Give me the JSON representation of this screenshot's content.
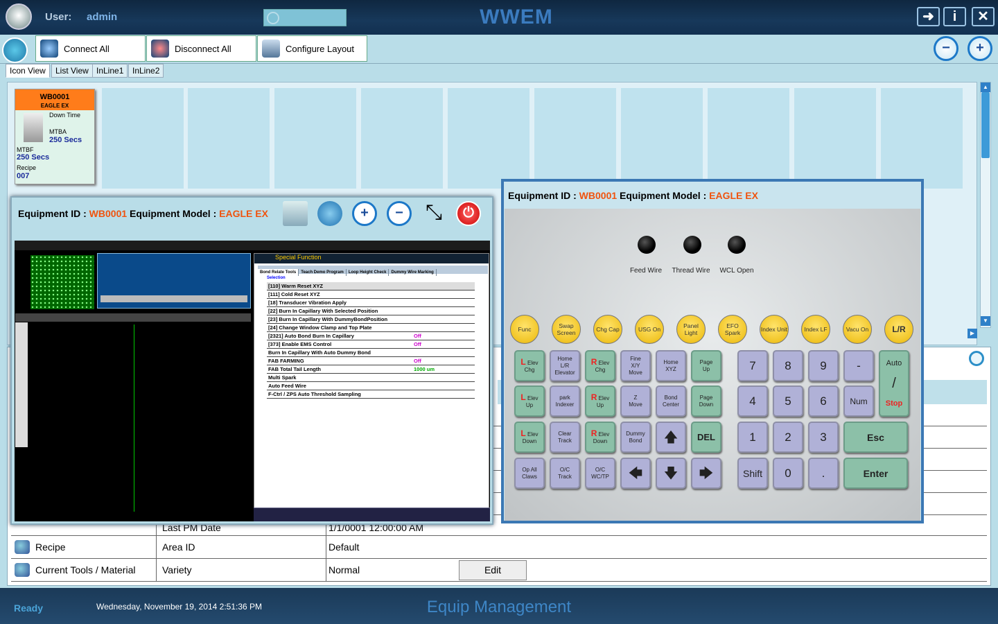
{
  "header": {
    "user_label": "User:",
    "user_name": "admin",
    "app_title": "WWEM"
  },
  "toolbar": {
    "connect_all": "Connect All",
    "disconnect_all": "Disconnect All",
    "configure_layout": "Configure Layout"
  },
  "tabs": [
    "Icon View",
    "List View",
    "InLine1",
    "InLine2"
  ],
  "tile": {
    "id": "WB0001",
    "model": "EAGLE EX",
    "down_time_label": "Down Time",
    "mtba_label": "MTBA",
    "mtba_value": "250 Secs",
    "mtbf_label": "MTBF",
    "mtbf_value": "250 Secs",
    "recipe_label": "Recipe",
    "recipe_value": "007"
  },
  "left_dialog": {
    "eq_id_label": "Equipment ID :",
    "eq_id": "WB0001",
    "eq_model_label": "Equipment Model :",
    "eq_model": "EAGLE EX"
  },
  "right_dialog": {
    "eq_id_label": "Equipment ID :",
    "eq_id": "WB0001",
    "eq_model_label": "Equipment Model :",
    "eq_model": "EAGLE EX"
  },
  "machine_screen": {
    "title": "Special Function",
    "tabs": [
      "Bond Relate Tools",
      "Teach Demo Program",
      "Loop Height Check",
      "Dummy Wire Marking"
    ],
    "selection_label": "Selection",
    "items": [
      {
        "label": "[110] Warm Reset XYZ",
        "status": ""
      },
      {
        "label": "[111] Cold Reset XYZ",
        "status": ""
      },
      {
        "label": "[18] Transducer Vibration Apply",
        "status": ""
      },
      {
        "label": "[22] Burn In Capillary With Selected Position",
        "status": ""
      },
      {
        "label": "[23] Burn In Capillary With DummyBondPosition",
        "status": ""
      },
      {
        "label": "[24] Change Window Clamp and Top Plate",
        "status": ""
      },
      {
        "label": "[2321] Auto Bond Burn In Capillary",
        "status": "Off"
      },
      {
        "label": "[373] Enable EMS Control",
        "status": "Off"
      },
      {
        "label": "Burn In Capillary With Auto Dummy Bond",
        "status": ""
      },
      {
        "label": "FAB FARMING",
        "status": "Off"
      },
      {
        "label": "FAB Total Tail Length",
        "status": "1000  um"
      },
      {
        "label": "Multi Spark",
        "status": ""
      },
      {
        "label": "Auto Feed Wire",
        "status": ""
      },
      {
        "label": "F-Ctrl / ZPS Auto Threshold Sampling",
        "status": ""
      }
    ]
  },
  "keypad": {
    "leds": [
      "Feed Wire",
      "Thread Wire",
      "WCL Open"
    ],
    "yellow_keys": [
      "Func",
      "Swap Screen",
      "Chg Cap",
      "USG On",
      "Panel Light",
      "EFO Spark",
      "Index Unit",
      "Index LF",
      "Vacu On",
      "L/R"
    ],
    "num_keys": [
      "7",
      "8",
      "9",
      "-",
      "4",
      "5",
      "6",
      "Num",
      "1",
      "2",
      "3",
      "Shift",
      "0",
      "."
    ],
    "auto_label": "Auto",
    "stop_label": "Stop",
    "esc_label": "Esc",
    "enter_label": "Enter",
    "del_label": "DEL",
    "func_label": "Func"
  },
  "details": {
    "rows": [
      {
        "left": "",
        "name": "Last PM Date",
        "value": "1/1/0001 12:00:00 AM"
      },
      {
        "left": "Recipe",
        "name": "Area ID",
        "value": "Default"
      },
      {
        "left": "Current Tools / Material",
        "name": "Variety",
        "value": "Normal"
      }
    ],
    "edit_label": "Edit"
  },
  "status": {
    "ready": "Ready",
    "datetime": "Wednesday, November 19, 2014 2:51:36 PM",
    "app_name": "Equip Management"
  },
  "colors": {
    "accent": "#f0530e",
    "title_blue": "#3b7bbf",
    "tile_header": "#ff7c1a"
  }
}
